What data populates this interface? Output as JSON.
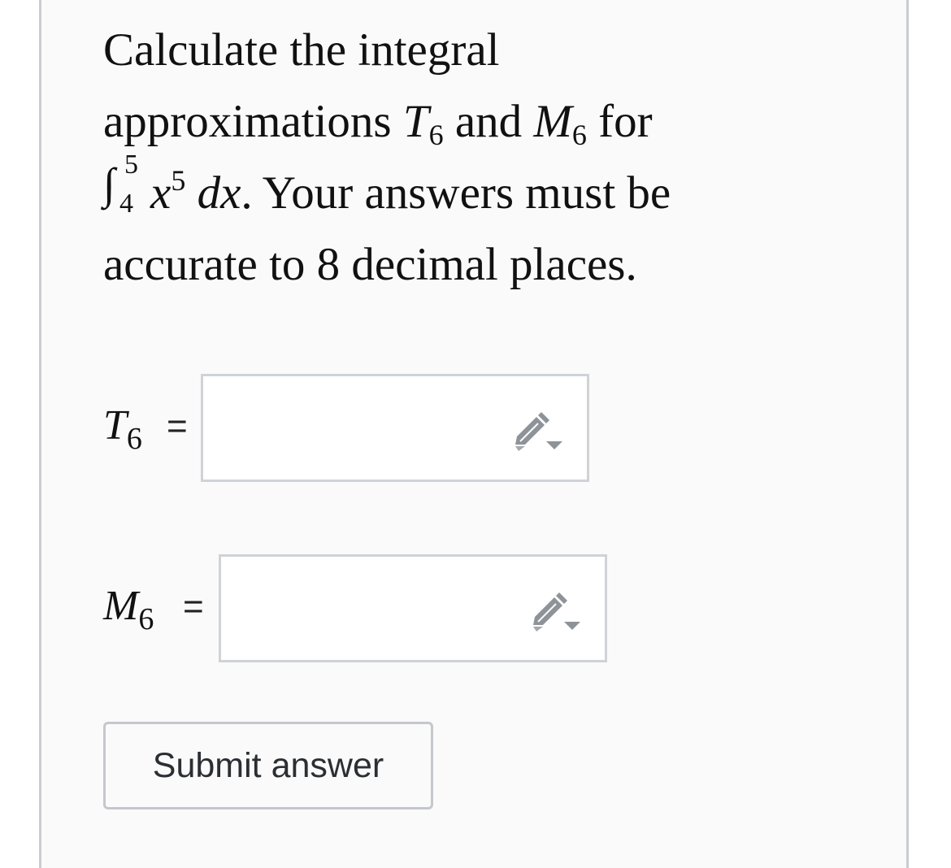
{
  "question": {
    "line1": "Calculate the integral",
    "line2_text1": "approximations ",
    "t_var": "T",
    "t_sub": "6",
    "line2_text2": " and ",
    "m_var": "M",
    "m_sub": "6",
    "line2_text3": " for",
    "integral_sign": "∫",
    "integral_lower": "4",
    "integral_upper": "5",
    "integrand_base": "x",
    "integrand_exp": "5",
    "differential": " dx",
    "line3_text": ". Your answers must be",
    "line4": "accurate to 8 decimal places."
  },
  "answers": [
    {
      "var": "T",
      "sub": "6",
      "equals": "=",
      "value": "",
      "icon": "pencil-dropdown-icon"
    },
    {
      "var": "M",
      "sub": "6",
      "equals": "=",
      "value": "",
      "icon": "pencil-dropdown-icon"
    }
  ],
  "submit_label": "Submit answer",
  "colors": {
    "card_bg": "#fafafa",
    "border": "#c9ccd1",
    "icon": "#8e9399",
    "button_text": "#2b2f33"
  }
}
